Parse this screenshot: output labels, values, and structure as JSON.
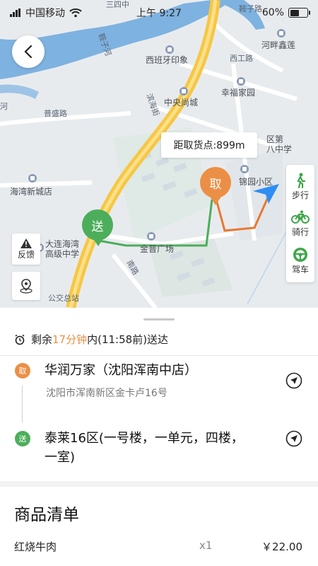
{
  "status_bar": {
    "carrier": "中国移动",
    "time": "上午 9:27",
    "battery": "60%",
    "battery_level": 0.6
  },
  "map": {
    "distance_label": "距取货点:899m",
    "pickup_marker": "取",
    "delivery_marker": "送",
    "pois": {
      "xibanya": "西班牙印象",
      "zhongyang": "中央尚城",
      "xingfu": "幸福家园",
      "hepan": "河畔鑫莲",
      "haiwan": "海湾新城店",
      "dalian": "大连海湾",
      "dalian2": "高级中学",
      "jinpu": "金普广场",
      "jinyuan": "锦园小区",
      "diyi": "区第",
      "diyi2": "八中学"
    },
    "roads": {
      "anzi_road": "鞍子路",
      "anzi_river": "鞍子河",
      "puyan": "普盛路",
      "xigong": "西工路",
      "binhai": "滨海街",
      "nanjie": "南路",
      "jiaotong": "公交总站",
      "top_road": "三四中",
      "zhang": "张",
      "he": "河"
    },
    "travel_modes": [
      {
        "label": "步行",
        "icon": "walk-icon"
      },
      {
        "label": "骑行",
        "icon": "bicycle-icon"
      },
      {
        "label": "驾车",
        "icon": "steering-wheel-icon"
      }
    ],
    "feedback_label": "反馈",
    "colors": {
      "pickup": "#ec8f46",
      "delivery": "#4cae5b",
      "river": "#7eb2e0",
      "road": "#f4c243",
      "me": "#2f8ef4"
    }
  },
  "order": {
    "time_prefix": "剩余",
    "time_remaining": "17分钟",
    "time_suffix": "内(11:58前)送达",
    "pickup": {
      "badge": "取",
      "name": "华润万家（沈阳浑南中店）",
      "address": "沈阳市浑南新区金卡卢16号"
    },
    "delivery": {
      "badge": "送",
      "name_line1": "泰莱16区(一号楼，一单元，四楼，",
      "name_line2": "一室)"
    },
    "items_title": "商品清单",
    "items": [
      {
        "name": "红烧牛肉",
        "qty": "x1",
        "price": "￥22.00"
      }
    ]
  }
}
